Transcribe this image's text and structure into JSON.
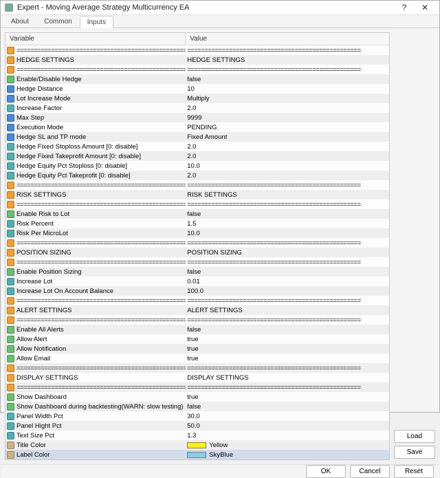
{
  "window": {
    "title": "Expert - Moving Average Strategy Multicurrency EA"
  },
  "tabs": {
    "about": "About",
    "common": "Common",
    "inputs": "Inputs"
  },
  "headers": {
    "variable": "Variable",
    "value": "Value"
  },
  "buttons": {
    "load": "Load",
    "save": "Save",
    "ok": "OK",
    "cancel": "Cancel",
    "reset": "Reset"
  },
  "sep": "==================================================",
  "rows": [
    {
      "ic": "i-orange",
      "label": "==================================================",
      "value": "==================================================",
      "sep": true
    },
    {
      "ic": "i-orange",
      "label": "HEDGE SETTINGS",
      "value": "HEDGE SETTINGS"
    },
    {
      "ic": "i-orange",
      "label": "==================================================",
      "value": "==================================================",
      "sep": true
    },
    {
      "ic": "i-green",
      "label": "Enable/Disable Hedge",
      "value": "false"
    },
    {
      "ic": "i-blue",
      "label": "Hedge Distance",
      "value": "10"
    },
    {
      "ic": "i-blue",
      "label": "Lot Increase Mode",
      "value": "Multiply"
    },
    {
      "ic": "i-teal",
      "label": "Increase Factor",
      "value": "2.0"
    },
    {
      "ic": "i-blue",
      "label": "Max Step",
      "value": "9999"
    },
    {
      "ic": "i-blue",
      "label": "Execution Mode",
      "value": "PENDING"
    },
    {
      "ic": "i-blue",
      "label": "Hedge SL and TP mode",
      "value": "Fixed Amount"
    },
    {
      "ic": "i-teal",
      "label": "Hedge Fixed Stoploss Amount [0: disable]",
      "value": "2.0"
    },
    {
      "ic": "i-teal",
      "label": "Hedge Fixed Takeprofit Amount [0: disable]",
      "value": "2.0"
    },
    {
      "ic": "i-teal",
      "label": "Hedge Equity Pct Stoploss [0: disable]",
      "value": "10.0"
    },
    {
      "ic": "i-teal",
      "label": "Hedge Equity Pct Takeprofit [0: disable]",
      "value": "2.0"
    },
    {
      "ic": "i-orange",
      "label": "==================================================",
      "value": "==================================================",
      "sep": true
    },
    {
      "ic": "i-orange",
      "label": "RISK SETTINGS",
      "value": "RISK SETTINGS"
    },
    {
      "ic": "i-orange",
      "label": "==================================================",
      "value": "==================================================",
      "sep": true
    },
    {
      "ic": "i-green",
      "label": "Enable Risk to Lot",
      "value": "false"
    },
    {
      "ic": "i-teal",
      "label": "Risk Percent",
      "value": "1.5"
    },
    {
      "ic": "i-teal",
      "label": "Risk Per MicroLot",
      "value": "10.0"
    },
    {
      "ic": "i-orange",
      "label": "==================================================",
      "value": "==================================================",
      "sep": true
    },
    {
      "ic": "i-orange",
      "label": "POSITION SIZING",
      "value": "POSITION SIZING"
    },
    {
      "ic": "i-orange",
      "label": "==================================================",
      "value": "==================================================",
      "sep": true
    },
    {
      "ic": "i-green",
      "label": "Enable Position Sizing",
      "value": "false"
    },
    {
      "ic": "i-teal",
      "label": "Increase Lot",
      "value": "0.01"
    },
    {
      "ic": "i-teal",
      "label": "Increase Lot On Account Balance",
      "value": "100.0"
    },
    {
      "ic": "i-orange",
      "label": "==================================================",
      "value": "==================================================",
      "sep": true
    },
    {
      "ic": "i-orange",
      "label": "ALERT SETTINGS",
      "value": "ALERT SETTINGS"
    },
    {
      "ic": "i-orange",
      "label": "==================================================",
      "value": "==================================================",
      "sep": true
    },
    {
      "ic": "i-green",
      "label": "Enable All Alerts",
      "value": "false"
    },
    {
      "ic": "i-green",
      "label": "Allow Alert",
      "value": "true"
    },
    {
      "ic": "i-green",
      "label": "Allow Notification",
      "value": "true"
    },
    {
      "ic": "i-green",
      "label": "Allow Email",
      "value": "true"
    },
    {
      "ic": "i-orange",
      "label": "==================================================",
      "value": "==================================================",
      "sep": true
    },
    {
      "ic": "i-orange",
      "label": "DISPLAY SETTINGS",
      "value": "DISPLAY SETTINGS"
    },
    {
      "ic": "i-orange",
      "label": "==================================================",
      "value": "==================================================",
      "sep": true
    },
    {
      "ic": "i-green",
      "label": "Show Dashboard",
      "value": "true"
    },
    {
      "ic": "i-green",
      "label": "Show Dashboard during backtesting(WARN: slow testing)",
      "value": "false"
    },
    {
      "ic": "i-teal",
      "label": "Panel Width Pct",
      "value": "30.0"
    },
    {
      "ic": "i-teal",
      "label": "Panel Hight Pct",
      "value": "50.0"
    },
    {
      "ic": "i-teal",
      "label": "Text Size Pct",
      "value": "1.3"
    },
    {
      "ic": "i-tan",
      "label": "Title Color",
      "value": "Yellow",
      "swatch": "#fff200"
    },
    {
      "ic": "i-tan",
      "label": "Label Color",
      "value": "SkyBlue",
      "swatch": "#87ceeb",
      "selected": true
    }
  ]
}
